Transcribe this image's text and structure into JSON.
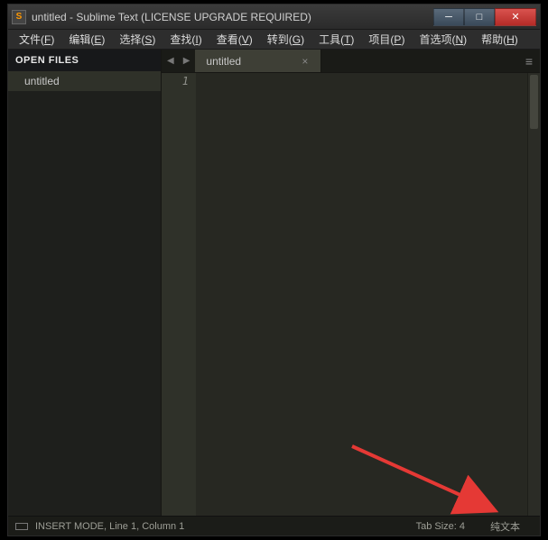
{
  "window": {
    "icon_letter": "S",
    "title": "untitled - Sublime Text (LICENSE UPGRADE REQUIRED)"
  },
  "menu": {
    "items": [
      {
        "label": "文件",
        "accel": "F"
      },
      {
        "label": "编辑",
        "accel": "E"
      },
      {
        "label": "选择",
        "accel": "S"
      },
      {
        "label": "查找",
        "accel": "I"
      },
      {
        "label": "查看",
        "accel": "V"
      },
      {
        "label": "转到",
        "accel": "G"
      },
      {
        "label": "工具",
        "accel": "T"
      },
      {
        "label": "项目",
        "accel": "P"
      },
      {
        "label": "首选项",
        "accel": "N"
      },
      {
        "label": "帮助",
        "accel": "H"
      }
    ]
  },
  "sidebar": {
    "header": "OPEN FILES",
    "items": [
      {
        "label": "untitled"
      }
    ]
  },
  "tabs": {
    "nav_prev": "◀",
    "nav_next": "▶",
    "menu_glyph": "≡",
    "items": [
      {
        "label": "untitled",
        "close": "×",
        "active": true
      }
    ]
  },
  "editor": {
    "line_numbers": [
      "1"
    ]
  },
  "statusbar": {
    "mode": "INSERT MODE, Line 1, Column 1",
    "tab_size": "Tab Size: 4",
    "syntax": "纯文本"
  },
  "win_controls": {
    "min": "─",
    "max": "□",
    "close": "✕"
  }
}
